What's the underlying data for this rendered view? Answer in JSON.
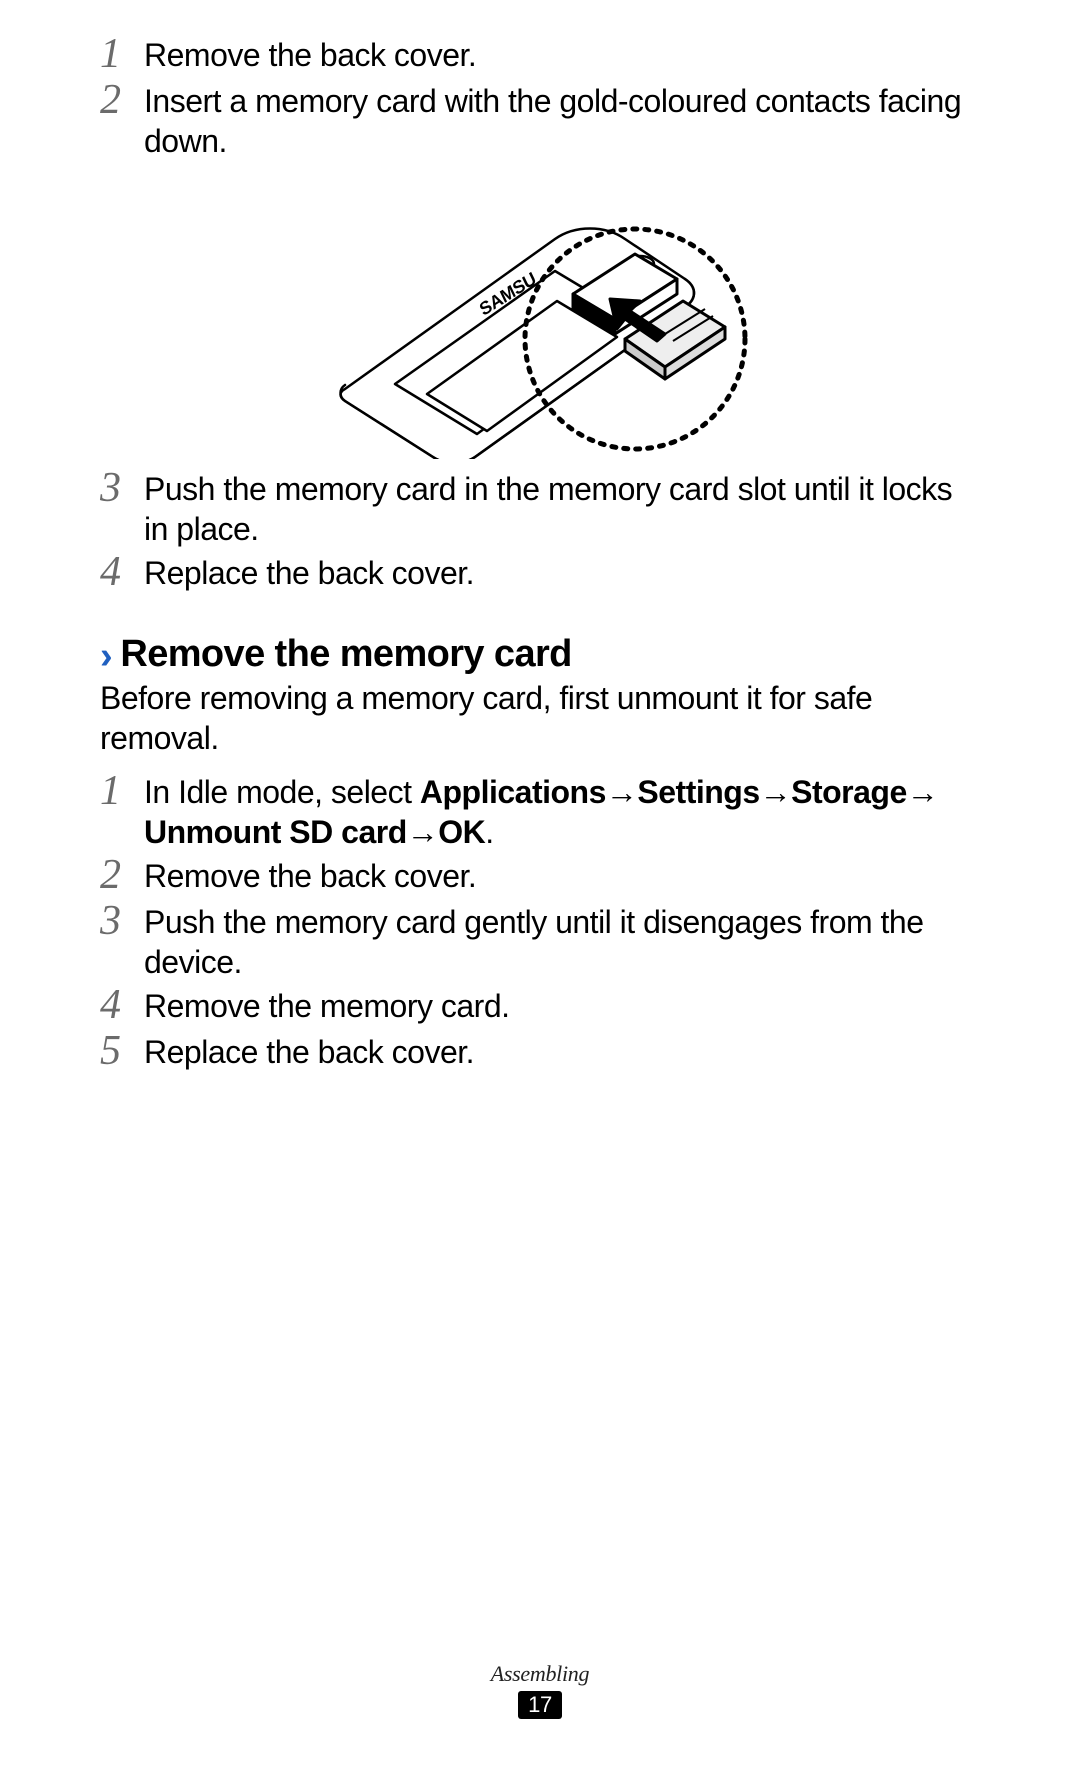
{
  "insert_steps": {
    "s1_num": "1",
    "s1_text": "Remove the back cover.",
    "s2_num": "2",
    "s2_text": "Insert a memory card with the gold-coloured contacts facing down.",
    "s3_num": "3",
    "s3_text": "Push the memory card in the memory card slot until it locks in place.",
    "s4_num": "4",
    "s4_text": "Replace the back cover."
  },
  "section": {
    "chevron": "›",
    "title": "Remove the memory card",
    "intro": "Before removing a memory card, first unmount it for safe removal."
  },
  "remove_steps": {
    "s1_num": "1",
    "s1_prefix": "In Idle mode, select ",
    "s1_b1": "Applications",
    "arrow": " → ",
    "s1_b2": "Settings",
    "s1_b3": "Storage",
    "s1_b4": "Unmount SD card",
    "s1_b5": "OK",
    "s1_period": ".",
    "s2_num": "2",
    "s2_text": "Remove the back cover.",
    "s3_num": "3",
    "s3_text": "Push the memory card gently until it disengages from the device.",
    "s4_num": "4",
    "s4_text": "Remove the memory card.",
    "s5_num": "5",
    "s5_text": "Replace the back cover."
  },
  "footer": {
    "label": "Assembling",
    "page": "17"
  },
  "illustration": {
    "alt": "Line drawing of the back of a Samsung phone with the cover removed, showing a memory card being inserted into the card slot. A dotted circle magnifies the slot area with an arrow indicating insertion direction."
  }
}
